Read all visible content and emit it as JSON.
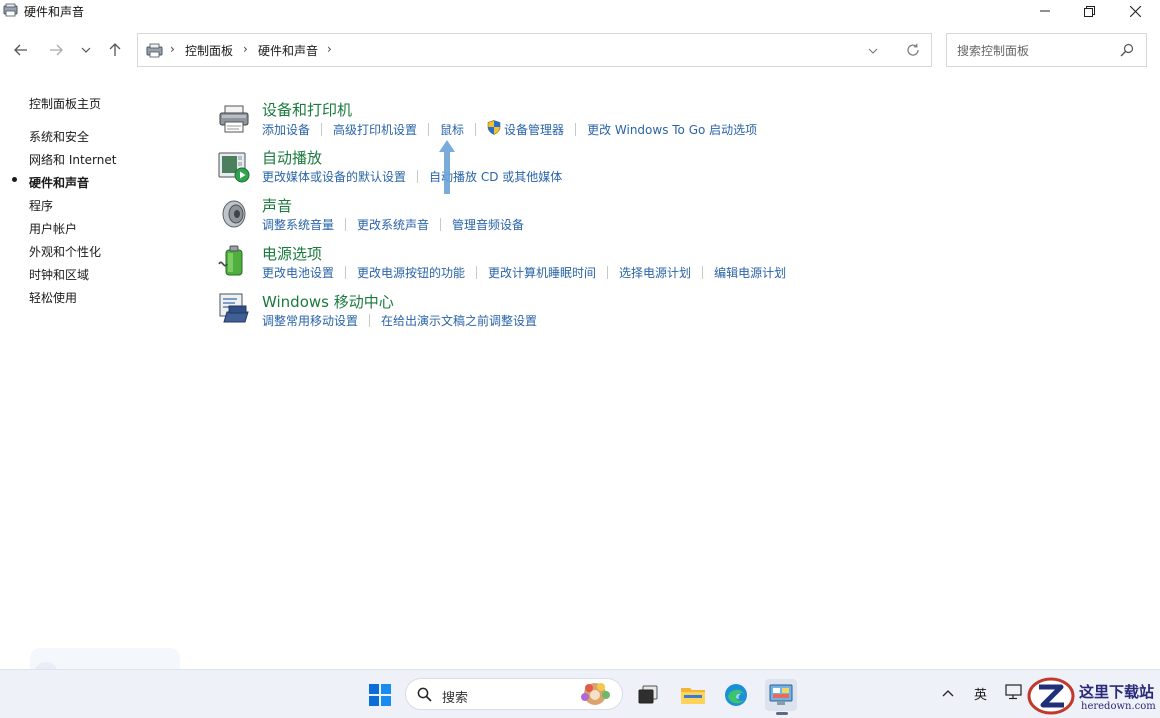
{
  "window": {
    "title": "硬件和声音"
  },
  "address_bar": {
    "crumbs": [
      "控制面板",
      "硬件和声音"
    ]
  },
  "search": {
    "placeholder": "搜索控制面板"
  },
  "sidebar": {
    "items": [
      {
        "label": "控制面板主页",
        "active": false
      },
      {
        "label": "系统和安全",
        "active": false
      },
      {
        "label": "网络和 Internet",
        "active": false
      },
      {
        "label": "硬件和声音",
        "active": true
      },
      {
        "label": "程序",
        "active": false
      },
      {
        "label": "用户帐户",
        "active": false
      },
      {
        "label": "外观和个性化",
        "active": false
      },
      {
        "label": "时钟和区域",
        "active": false
      },
      {
        "label": "轻松使用",
        "active": false
      }
    ]
  },
  "categories": [
    {
      "icon": "printer-icon",
      "title": "设备和打印机",
      "links": [
        "添加设备",
        "高级打印机设置",
        "鼠标",
        "设备管理器",
        "更改 Windows To Go 启动选项"
      ]
    },
    {
      "icon": "autoplay-icon",
      "title": "自动播放",
      "links": [
        "更改媒体或设备的默认设置",
        "自动播放 CD 或其他媒体"
      ]
    },
    {
      "icon": "speaker-icon",
      "title": "声音",
      "links": [
        "调整系统音量",
        "更改系统声音",
        "管理音频设备"
      ]
    },
    {
      "icon": "battery-icon",
      "title": "电源选项",
      "links": [
        "更改电池设置",
        "更改电源按钮的功能",
        "更改计算机睡眠时间",
        "选择电源计划",
        "编辑电源计划"
      ]
    },
    {
      "icon": "mobility-center-icon",
      "title": "Windows 移动中心",
      "links": [
        "调整常用移动设置",
        "在给出演示文稿之前调整设置"
      ]
    }
  ],
  "taskbar": {
    "search_label": "搜索",
    "tray_lang": "英"
  },
  "watermark": {
    "name": "这里下载站",
    "url": "heredown.com"
  },
  "colors": {
    "category_title": "#1b7a3d",
    "link": "#2a64a8",
    "annotation_arrow": "#6aa3d6"
  }
}
